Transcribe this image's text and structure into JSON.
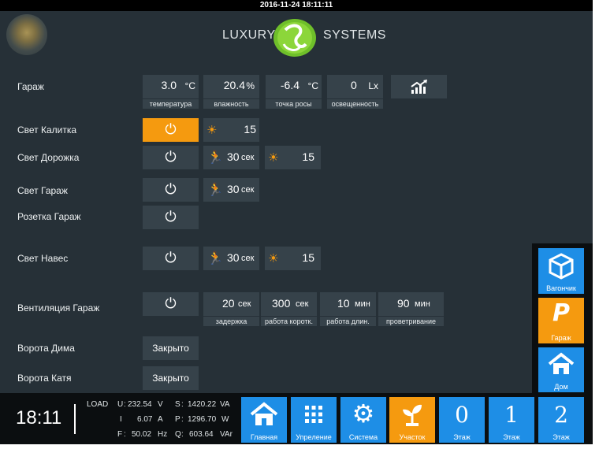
{
  "datetime": "2016-11-24 18:11:11",
  "logo": {
    "left": "LUXURY",
    "right": "SYSTEMS"
  },
  "garage_sensor": {
    "label": "Гараж",
    "temperature": {
      "value": "3.0",
      "unit": "°C",
      "caption": "температура"
    },
    "humidity": {
      "value": "20.4",
      "unit": "%",
      "caption": "влажность"
    },
    "dew_point": {
      "value": "-6.4",
      "unit": "°C",
      "caption": "точка росы"
    },
    "illuminance": {
      "value": "0",
      "unit": "Lx",
      "caption": "освещенность"
    }
  },
  "rows": {
    "svet_kalitka": {
      "label": "Свет Калитка",
      "brightness": "15"
    },
    "svet_dorozhka": {
      "label": "Свет Дорожка",
      "motion": "30",
      "motion_unit": "сек",
      "brightness": "15"
    },
    "svet_garazh": {
      "label": "Свет Гараж",
      "motion": "30",
      "motion_unit": "сек"
    },
    "rozetka_garazh": {
      "label": "Розетка Гараж"
    },
    "svet_naves": {
      "label": "Свет Навес",
      "motion": "30",
      "motion_unit": "сек",
      "brightness": "15"
    },
    "ventilation": {
      "label": "Вентиляция Гараж",
      "delay": {
        "value": "20",
        "unit": "сек",
        "caption": "задержка"
      },
      "short": {
        "value": "300",
        "unit": "сек",
        "caption": "работа коротк."
      },
      "long": {
        "value": "10",
        "unit": "мин",
        "caption": "работа длин."
      },
      "airing": {
        "value": "90",
        "unit": "мин",
        "caption": "проветривание"
      }
    },
    "vorota_dima": {
      "label": "Ворота Дима",
      "state": "Закрыто"
    },
    "vorota_katya": {
      "label": "Ворота Катя",
      "state": "Закрыто"
    }
  },
  "side_nav": [
    {
      "label": "Вагончик"
    },
    {
      "label": "Гараж"
    },
    {
      "label": "Дом"
    }
  ],
  "status": {
    "clock": "18:11",
    "load_label": "LOAD",
    "u_label": "U",
    "u_value": "232.54",
    "u_unit": "V",
    "i_label": "I",
    "i_value": "6.07",
    "i_unit": "A",
    "f_label": "F",
    "f_value": "50.02",
    "f_unit": "Hz",
    "s_label": "S",
    "s_value": "1420.22",
    "s_unit": "VA",
    "p_label": "P",
    "p_value": "1296.70",
    "p_unit": "W",
    "q_label": "Q",
    "q_value": "603.64",
    "q_unit": "VAr"
  },
  "bottom_nav": [
    {
      "label": "Главная"
    },
    {
      "label": "Упрeление"
    },
    {
      "label": "Система"
    },
    {
      "label": "Участок"
    },
    {
      "number": "0",
      "label": "Этаж"
    },
    {
      "number": "1",
      "label": "Этаж"
    },
    {
      "number": "2",
      "label": "Этаж"
    }
  ],
  "colors": {
    "background": "#263037",
    "cell": "#36424a",
    "accent": "#f59a0f",
    "nav_blue": "#1e8ee6"
  }
}
